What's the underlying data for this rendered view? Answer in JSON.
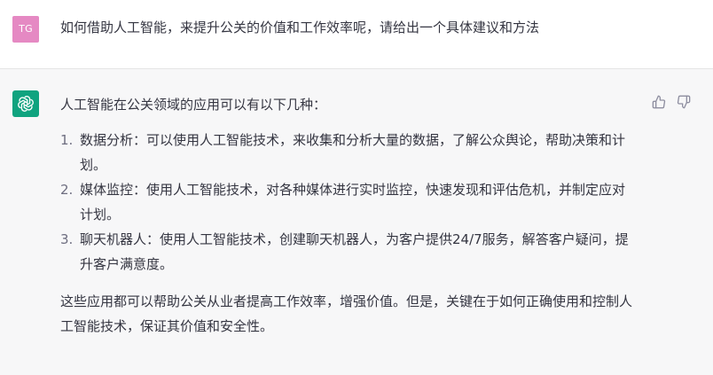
{
  "user": {
    "avatar_initials": "TG",
    "avatar_color": "#e589c3",
    "message": "如何借助人工智能，来提升公关的价值和工作效率呢，请给出一个具体建议和方法"
  },
  "assistant": {
    "avatar_icon": "openai-logo-icon",
    "avatar_color": "#10a37f",
    "intro": "人工智能在公关领域的应用可以有以下几种：",
    "points": [
      {
        "num": "1.",
        "text": "数据分析：可以使用人工智能技术，来收集和分析大量的数据，了解公众舆论，帮助决策和计划。"
      },
      {
        "num": "2.",
        "text": "媒体监控：使用人工智能技术，对各种媒体进行实时监控，快速发现和评估危机，并制定应对计划。"
      },
      {
        "num": "3.",
        "text": "聊天机器人：使用人工智能技术，创建聊天机器人，为客户提供24/7服务，解答客户疑问，提升客户满意度。"
      }
    ],
    "closing": "这些应用都可以帮助公关从业者提高工作效率，增强价值。但是，关键在于如何正确使用和控制人工智能技术，保证其价值和安全性。"
  },
  "feedback": {
    "thumbs_up_icon": "thumbs-up-icon",
    "thumbs_down_icon": "thumbs-down-icon"
  }
}
